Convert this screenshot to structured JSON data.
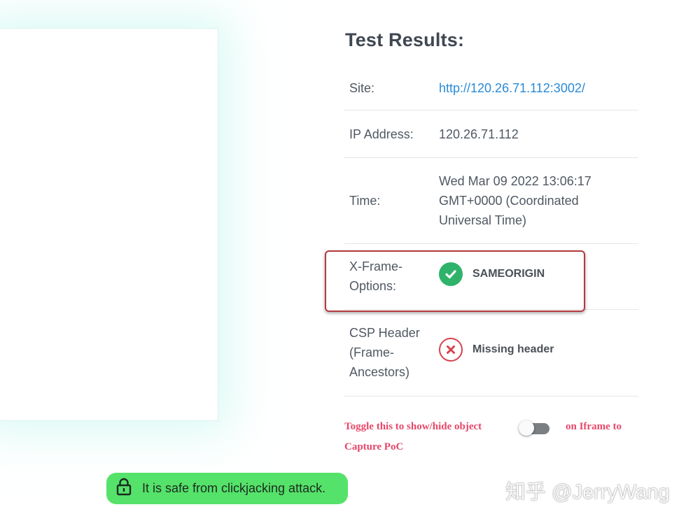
{
  "results": {
    "title": "Test Results:",
    "site": {
      "label": "Site:",
      "value": "http://120.26.71.112:3002/"
    },
    "ip": {
      "label": "IP Address:",
      "value": "120.26.71.112"
    },
    "time": {
      "label": "Time:",
      "line1": "Wed Mar 09 2022 13:06:17",
      "line2": "GMT+0000 (Coordinated",
      "line3": "Universal Time)"
    },
    "xframe": {
      "label1": "X-Frame-",
      "label2": "Options:",
      "value": "SAMEORIGIN",
      "icon": "check-icon"
    },
    "csp": {
      "label1": "CSP Header",
      "label2": "(Frame-",
      "label3": "Ancestors)",
      "value": "Missing header",
      "icon": "x-icon"
    }
  },
  "toggle": {
    "text_part1": "Toggle this to show/hide object",
    "text_part2": "on Iframe to",
    "text_part3": "Capture PoC",
    "state": "off"
  },
  "safe_banner": {
    "text": "It is safe from clickjacking attack.",
    "icon": "lock-icon",
    "color": "#55e26a"
  },
  "watermark": {
    "text": "知乎 @JerryWang"
  },
  "colors": {
    "link": "#2a8bd6",
    "ok": "#2fb36a",
    "error": "#d9414c",
    "toggle_text": "#e6476a",
    "highlight": "#b43a3e"
  }
}
